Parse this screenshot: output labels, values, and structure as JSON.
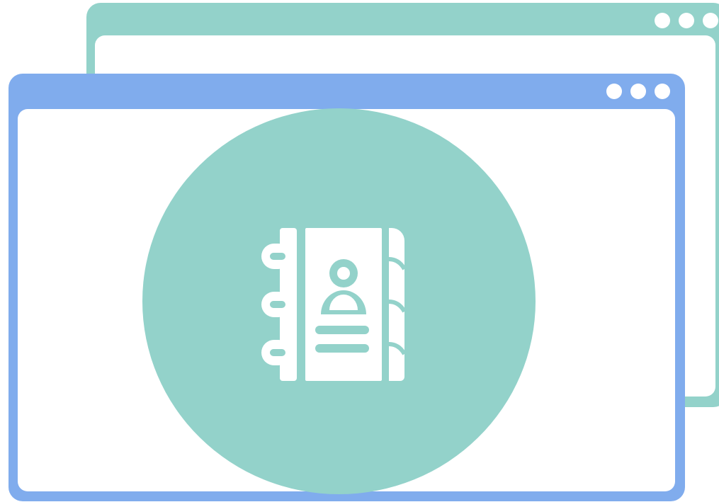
{
  "colors": {
    "back_window_frame": "#93d2ca",
    "front_window_frame": "#80aced",
    "circle": "#93d2ca",
    "icon": "#ffffff",
    "background": "#ffffff"
  },
  "windows": [
    {
      "name": "back-window",
      "dot_count": 3
    },
    {
      "name": "front-window",
      "dot_count": 3
    }
  ],
  "icons": {
    "main": "address-book-icon",
    "window_controls": "three-dots-icon"
  }
}
